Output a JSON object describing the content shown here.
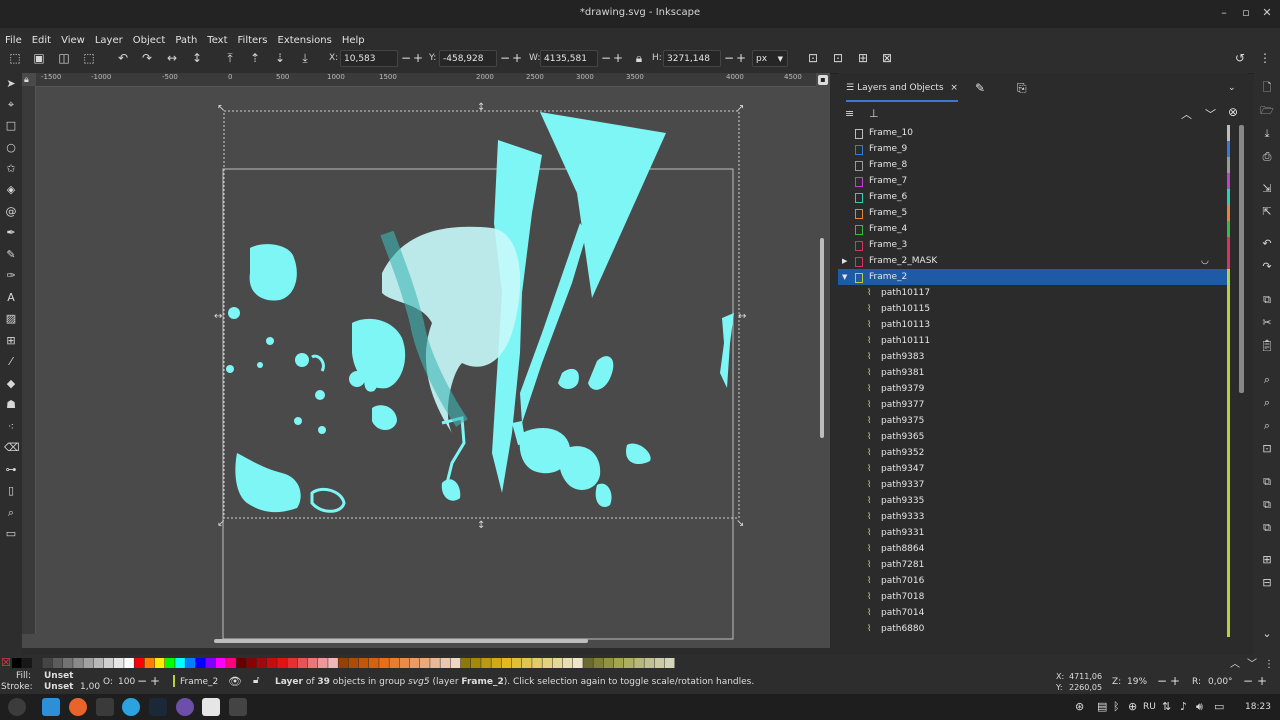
{
  "window": {
    "title": "*drawing.svg - Inkscape"
  },
  "menu": [
    "File",
    "Edit",
    "View",
    "Layer",
    "Object",
    "Path",
    "Text",
    "Filters",
    "Extensions",
    "Help"
  ],
  "toolbar": {
    "x_label": "X:",
    "x_value": "10,583",
    "y_label": "Y:",
    "y_value": "-458,928",
    "w_label": "W:",
    "w_value": "4135,581",
    "h_label": "H:",
    "h_value": "3271,148",
    "unit": "px"
  },
  "ruler": {
    "ticks": [
      "-1500",
      "-1000",
      "-500",
      "0",
      "500",
      "1000",
      "1500",
      "2000",
      "2500",
      "3000",
      "3500",
      "4000",
      "4500"
    ]
  },
  "dock": {
    "tab_label": "Layers and Objects",
    "tab_close": "×",
    "layers": [
      {
        "name": "Frame_10",
        "color": "#bdbdbd",
        "type": "layer"
      },
      {
        "name": "Frame_9",
        "color": "#3a78d8",
        "type": "layer"
      },
      {
        "name": "Frame_8",
        "color": "#9a9a9a",
        "type": "layer"
      },
      {
        "name": "Frame_7",
        "color": "#b548c6",
        "type": "layer"
      },
      {
        "name": "Frame_6",
        "color": "#2ecfb3",
        "type": "layer"
      },
      {
        "name": "Frame_5",
        "color": "#e8823a",
        "type": "layer"
      },
      {
        "name": "Frame_4",
        "color": "#3fb84a",
        "type": "layer"
      },
      {
        "name": "Frame_3",
        "color": "#d8345f",
        "type": "layer"
      },
      {
        "name": "Frame_2_MASK",
        "color": "#d8345f",
        "type": "layer",
        "collapsed": true
      },
      {
        "name": "Frame_2",
        "color": "#b6d13a",
        "type": "layer",
        "expanded": true,
        "selected": true
      },
      {
        "name": "path10117",
        "color": "#b6d13a",
        "type": "path"
      },
      {
        "name": "path10115",
        "color": "#b6d13a",
        "type": "path"
      },
      {
        "name": "path10113",
        "color": "#b6d13a",
        "type": "path"
      },
      {
        "name": "path10111",
        "color": "#b6d13a",
        "type": "path"
      },
      {
        "name": "path9383",
        "color": "#b6d13a",
        "type": "path"
      },
      {
        "name": "path9381",
        "color": "#b6d13a",
        "type": "path"
      },
      {
        "name": "path9379",
        "color": "#b6d13a",
        "type": "path"
      },
      {
        "name": "path9377",
        "color": "#b6d13a",
        "type": "path"
      },
      {
        "name": "path9375",
        "color": "#b6d13a",
        "type": "path"
      },
      {
        "name": "path9365",
        "color": "#b6d13a",
        "type": "path"
      },
      {
        "name": "path9352",
        "color": "#b6d13a",
        "type": "path"
      },
      {
        "name": "path9347",
        "color": "#b6d13a",
        "type": "path"
      },
      {
        "name": "path9337",
        "color": "#b6d13a",
        "type": "path"
      },
      {
        "name": "path9335",
        "color": "#b6d13a",
        "type": "path"
      },
      {
        "name": "path9333",
        "color": "#b6d13a",
        "type": "path"
      },
      {
        "name": "path9331",
        "color": "#b6d13a",
        "type": "path"
      },
      {
        "name": "path8864",
        "color": "#b6d13a",
        "type": "path"
      },
      {
        "name": "path7281",
        "color": "#b6d13a",
        "type": "path"
      },
      {
        "name": "path7016",
        "color": "#b6d13a",
        "type": "path"
      },
      {
        "name": "path7018",
        "color": "#b6d13a",
        "type": "path"
      },
      {
        "name": "path7014",
        "color": "#b6d13a",
        "type": "path"
      },
      {
        "name": "path6880",
        "color": "#b6d13a",
        "type": "path"
      }
    ]
  },
  "status": {
    "fill_label": "Fill:",
    "fill_value": "Unset",
    "stroke_label": "Stroke:",
    "stroke_value": "Unset",
    "stroke_width": "1,00",
    "opacity_label": "O:",
    "opacity_value": "100",
    "layer_name": "Frame_2",
    "message_pre": "Layer",
    "message_of": " of ",
    "message_count": "39",
    "message_mid": " objects in group ",
    "message_group": "svg5",
    "message_layer_pre": " (layer ",
    "message_layer": "Frame_2",
    "message_post": "). Click selection again to toggle scale/rotation handles.",
    "cursor_x_label": "X:",
    "cursor_x": "4711,06",
    "cursor_y_label": "Y:",
    "cursor_y": "2260,05",
    "zoom_label": "Z:",
    "zoom_value": "19%",
    "rotation_label": "R:",
    "rotation_value": "0,00°"
  },
  "taskbar": {
    "lang": "RU",
    "time": "18:23"
  },
  "colors": {
    "accent": "#1f5aa6",
    "shape": "#7ef6f6",
    "canvas": "#4a4a4a"
  }
}
